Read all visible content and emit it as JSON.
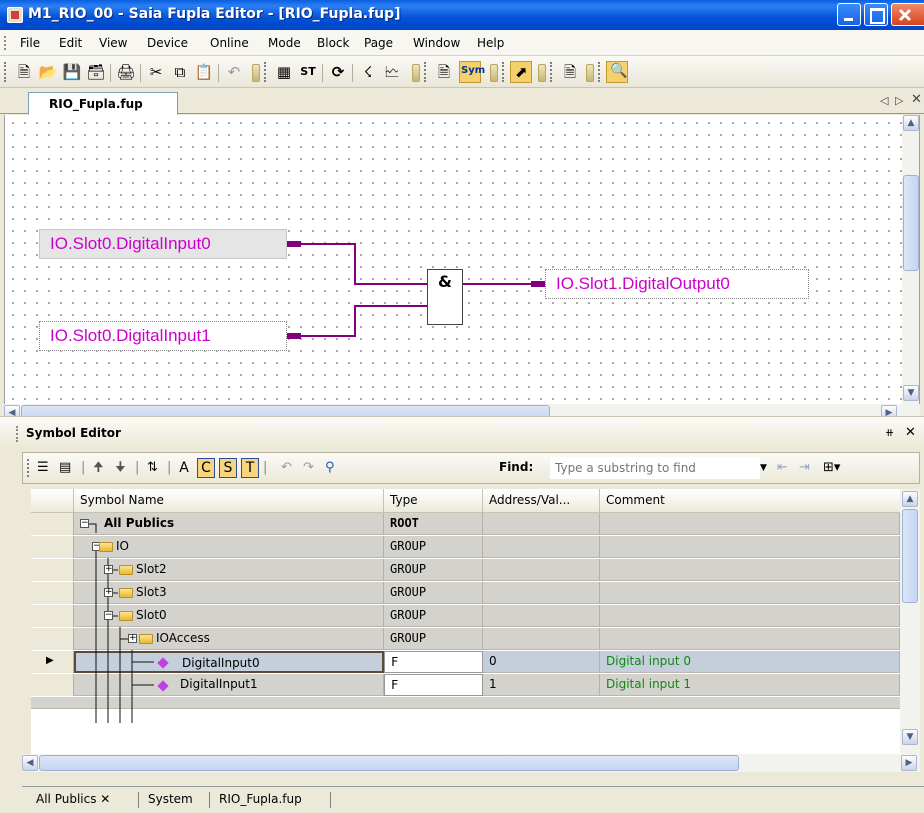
{
  "window": {
    "title": "M1_RIO_00 - Saia Fupla Editor - [RIO_Fupla.fup]"
  },
  "menu": [
    "File",
    "Edit",
    "View",
    "Device",
    "Online",
    "Mode",
    "Block",
    "Page",
    "Window",
    "Help"
  ],
  "toolbar": {
    "sym_label": "Sym"
  },
  "document_tab": {
    "label": "RIO_Fupla.fup"
  },
  "canvas": {
    "inputs": [
      "IO.Slot0.DigitalInput0",
      "IO.Slot0.DigitalInput1"
    ],
    "gate_label": "&",
    "output": "IO.Slot1.DigitalOutput0"
  },
  "symbol_editor": {
    "title": "Symbol Editor",
    "filter_buttons": [
      "A",
      "C",
      "S",
      "T"
    ],
    "find_label": "Find:",
    "find_placeholder": "Type a substring to find",
    "columns": [
      "Symbol Name",
      "Type",
      "Address/Val...",
      "Comment"
    ],
    "rows": [
      {
        "name": "All Publics",
        "type": "ROOT",
        "address": "",
        "comment": ""
      },
      {
        "name": "IO",
        "type": "GROUP",
        "address": "",
        "comment": ""
      },
      {
        "name": "Slot2",
        "type": "GROUP",
        "address": "",
        "comment": ""
      },
      {
        "name": "Slot3",
        "type": "GROUP",
        "address": "",
        "comment": ""
      },
      {
        "name": "Slot0",
        "type": "GROUP",
        "address": "",
        "comment": ""
      },
      {
        "name": "IOAccess",
        "type": "GROUP",
        "address": "",
        "comment": ""
      },
      {
        "name": "DigitalInput0",
        "type": "F",
        "address": "0",
        "comment": "Digital input 0"
      },
      {
        "name": "DigitalInput1",
        "type": "F",
        "address": "1",
        "comment": "Digital input 1"
      }
    ]
  },
  "bottom_tabs": [
    "All Publics",
    "System",
    "RIO_Fupla.fup"
  ],
  "colors": {
    "signal": "#800080",
    "io_text": "#cc00cc",
    "comment": "#118811"
  }
}
